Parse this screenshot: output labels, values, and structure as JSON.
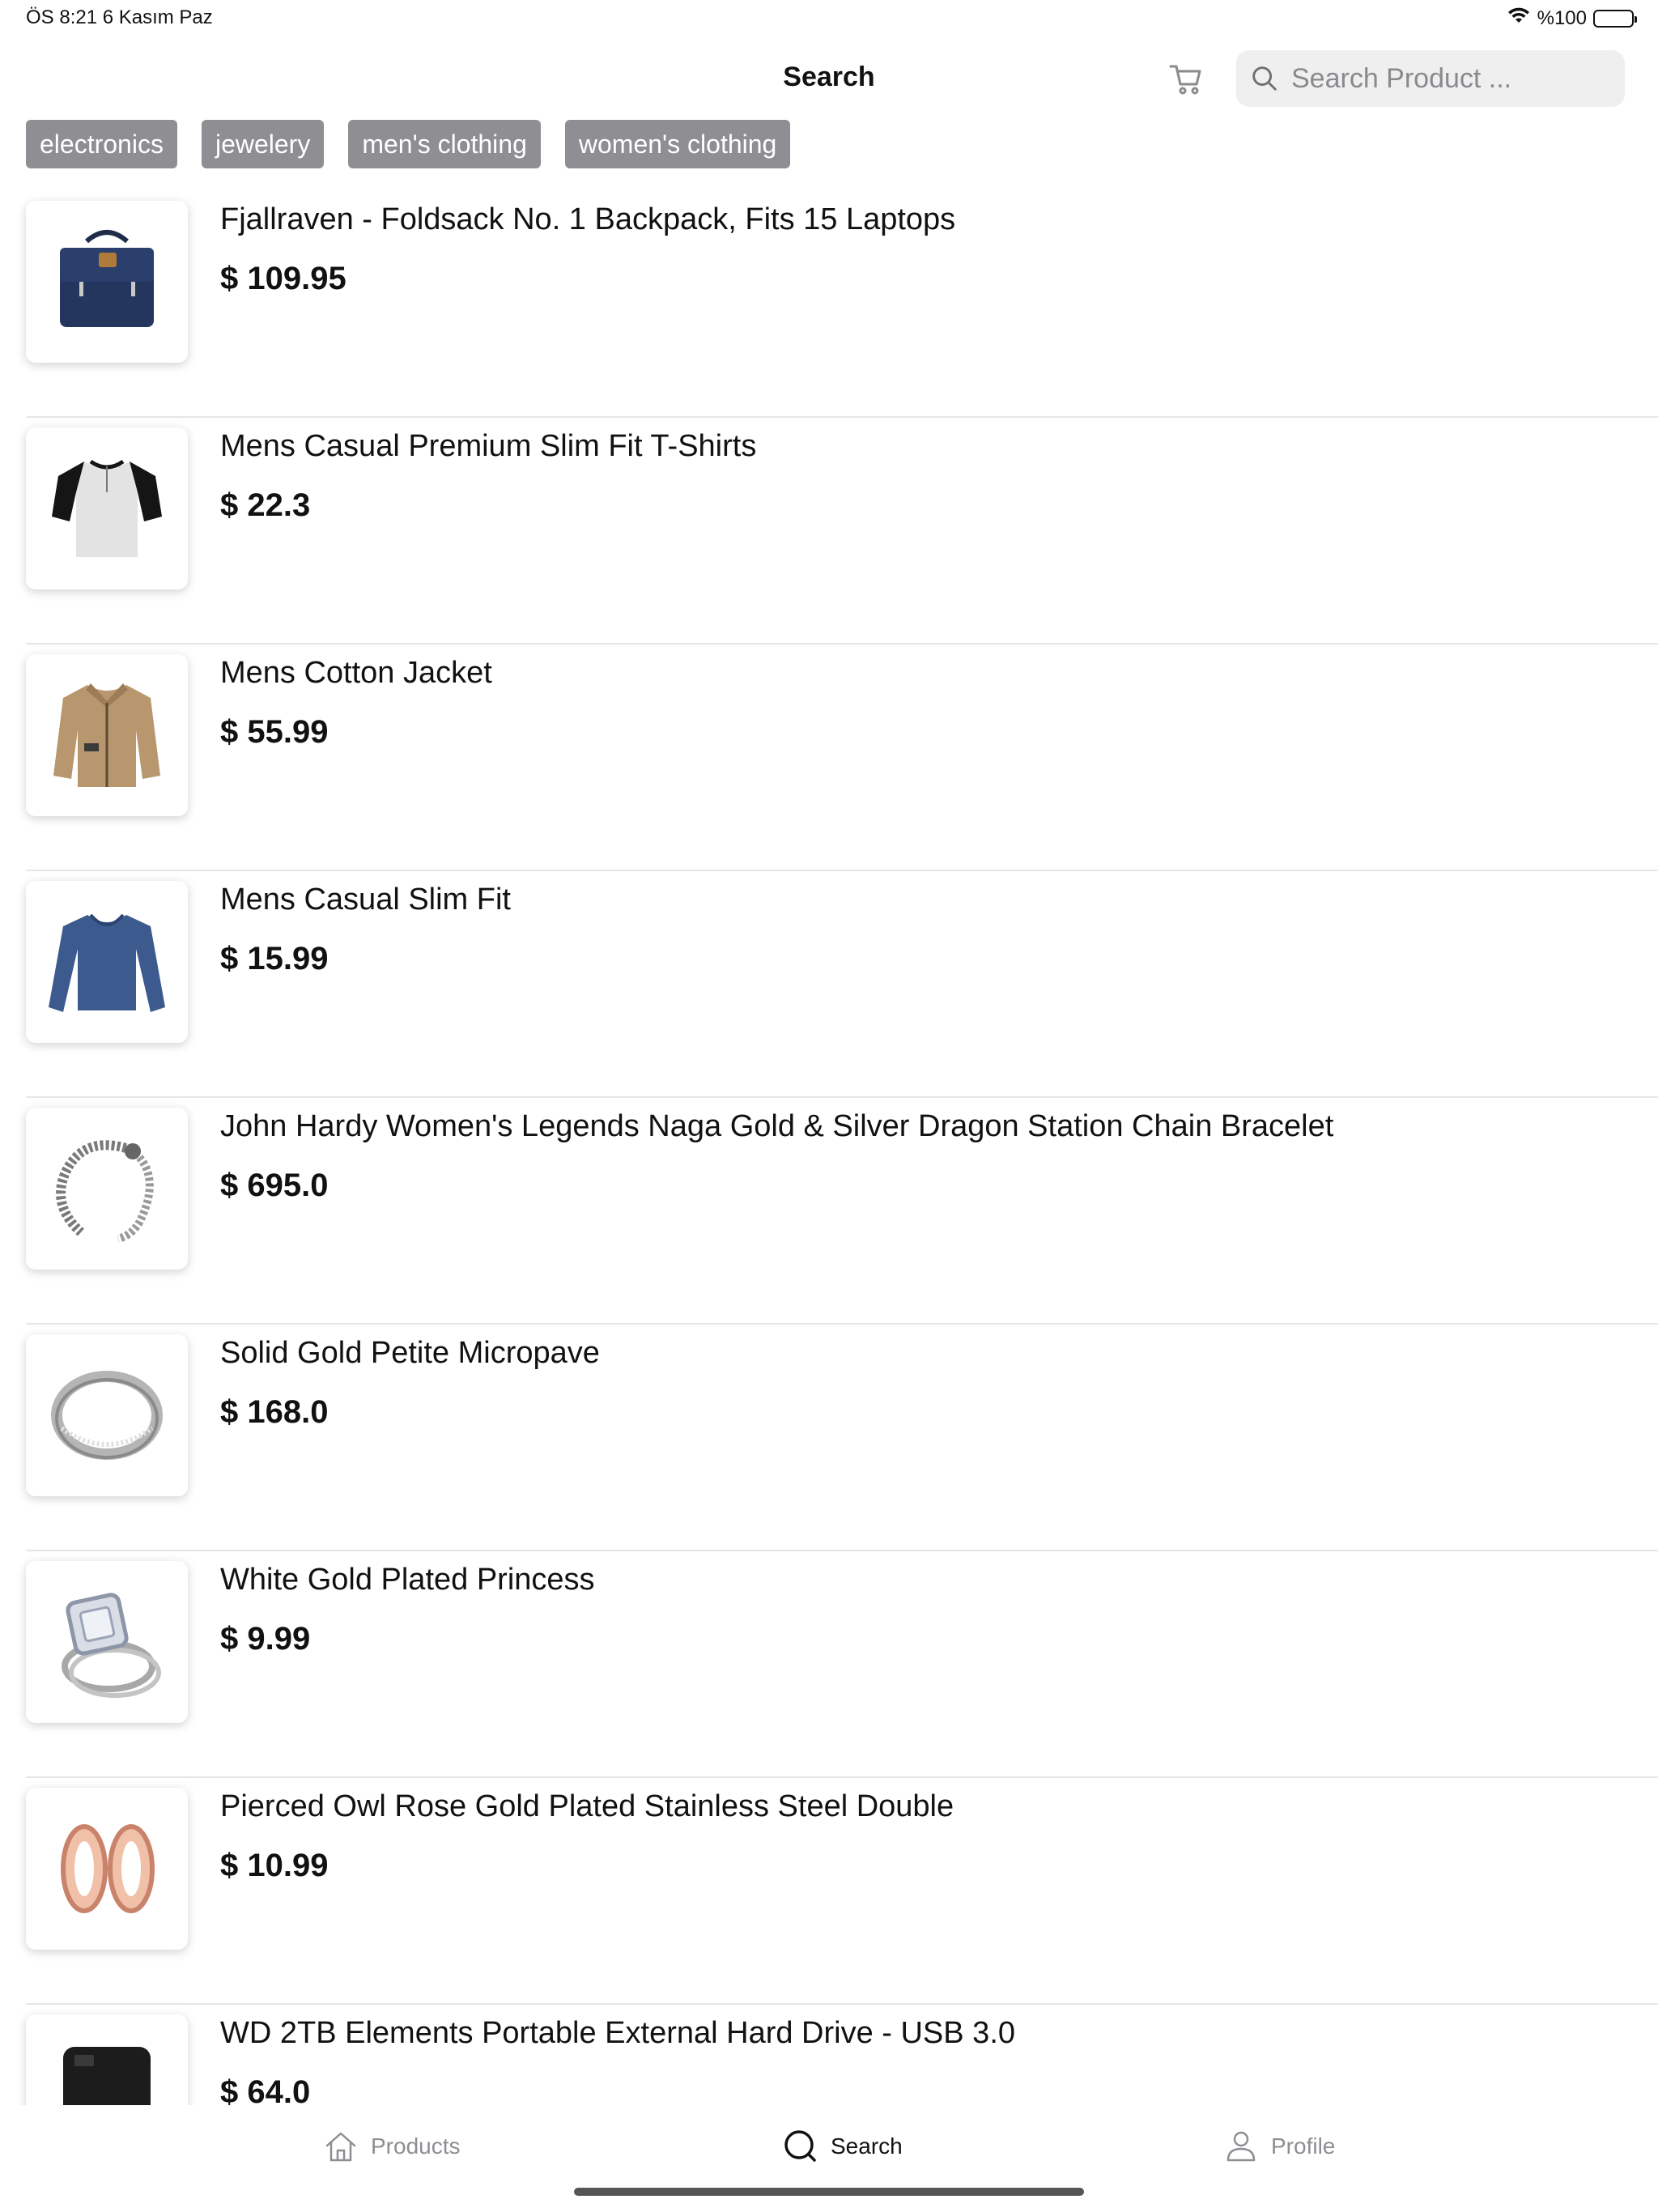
{
  "status_bar": {
    "time_date": "ÖS 8:21   6 Kasım Paz",
    "battery": "%100",
    "battery_level": 1.0
  },
  "header": {
    "title": "Search",
    "search_placeholder": "Search Product ..."
  },
  "categories": [
    "electronics",
    "jewelery",
    "men's clothing",
    "women's clothing"
  ],
  "products": [
    {
      "name": "Fjallraven - Foldsack No. 1 Backpack, Fits 15 Laptops",
      "price": "$ 109.95",
      "image_icon": "backpack-icon"
    },
    {
      "name": "Mens Casual Premium Slim Fit T-Shirts",
      "price": "$ 22.3",
      "image_icon": "tshirt-icon"
    },
    {
      "name": "Mens Cotton Jacket",
      "price": "$ 55.99",
      "image_icon": "jacket-icon"
    },
    {
      "name": "Mens Casual Slim Fit",
      "price": "$ 15.99",
      "image_icon": "longsleeve-icon"
    },
    {
      "name": "John Hardy Women's Legends Naga Gold & Silver Dragon Station Chain Bracelet",
      "price": "$ 695.0",
      "image_icon": "bracelet-icon"
    },
    {
      "name": "Solid Gold Petite Micropave",
      "price": "$ 168.0",
      "image_icon": "ring-icon"
    },
    {
      "name": "White Gold Plated Princess",
      "price": "$ 9.99",
      "image_icon": "diamond-ring-icon"
    },
    {
      "name": "Pierced Owl Rose Gold Plated Stainless Steel Double",
      "price": "$ 10.99",
      "image_icon": "earrings-icon"
    },
    {
      "name": "WD 2TB Elements Portable External Hard Drive - USB 3.0",
      "price": "$ 64.0",
      "image_icon": "hard-drive-icon"
    }
  ],
  "tabbar": {
    "tabs": [
      {
        "label": "Products",
        "icon": "home-icon",
        "active": false
      },
      {
        "label": "Search",
        "icon": "search-icon",
        "active": true
      },
      {
        "label": "Profile",
        "icon": "person-icon",
        "active": false
      }
    ]
  },
  "colors": {
    "chip_bg": "#8e8e93",
    "search_bg": "#efeff0",
    "tab_inactive": "#8e8e93",
    "tab_active": "#111111"
  }
}
